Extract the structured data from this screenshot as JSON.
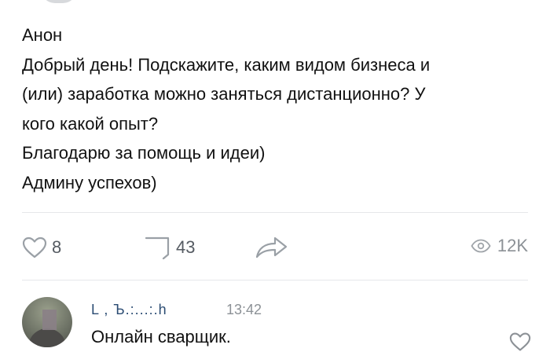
{
  "post": {
    "author": "Анон",
    "lines": [
      "Добрый день! Подскажите, каким видом бизнеса и",
      "(или) заработка можно заняться дистанционно? У",
      "кого какой опыт?",
      "Благодарю за помощь и идеи)",
      "Админу успехов)"
    ]
  },
  "actions": {
    "likes": "8",
    "comments": "43",
    "views": "12K"
  },
  "comment": {
    "author": "L , Ъ.:...:.h",
    "time": "13:42",
    "text": "Онлайн сварщик."
  },
  "icons": {
    "like": "heart-icon",
    "comment": "comment-icon",
    "share": "share-arrow-icon",
    "views": "eye-icon",
    "comment_like": "heart-icon"
  },
  "colors": {
    "text": "#111111",
    "muted": "#8c9196",
    "link": "#2b4c73",
    "divider": "#e6e7ea"
  }
}
